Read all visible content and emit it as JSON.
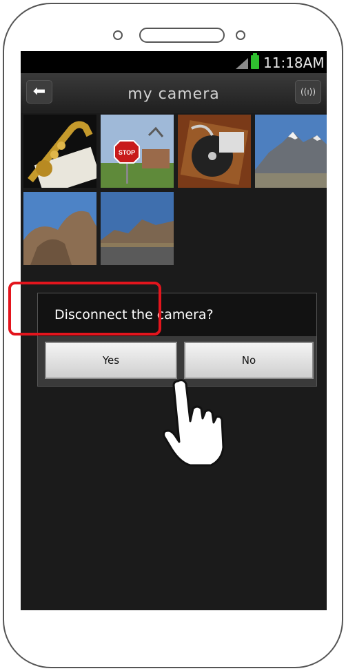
{
  "status_bar": {
    "time": "11:18AM"
  },
  "header": {
    "title": "my camera",
    "back_icon": "back-arrow-icon",
    "connection_icon": "wifi-connection-icon",
    "connection_glyph": "((ı))"
  },
  "gallery": {
    "thumbnails": [
      {
        "name": "saxophone-photo"
      },
      {
        "name": "stop-sign-photo"
      },
      {
        "name": "gramophone-photo"
      },
      {
        "name": "mountain-photo"
      },
      {
        "name": "rock-formation-photo"
      },
      {
        "name": "desert-road-photo"
      }
    ]
  },
  "dialog": {
    "message": "Disconnect the camera?",
    "yes_label": "Yes",
    "no_label": "No"
  },
  "annotation": {
    "highlight_color": "#e3151d",
    "pointer_icon": "pointing-hand-icon"
  }
}
